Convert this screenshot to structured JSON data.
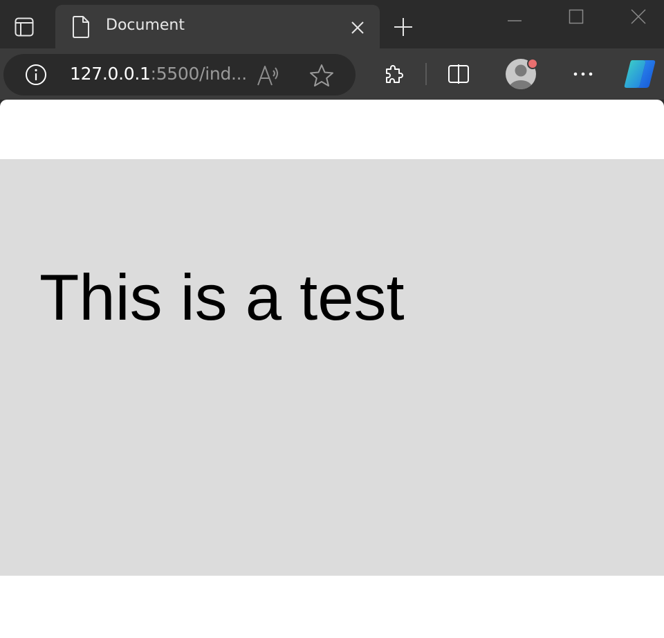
{
  "tab": {
    "title": "Document"
  },
  "address_bar": {
    "url_host": "127.0.0.1",
    "url_rest": ":5500/ind..."
  },
  "page": {
    "heading": "This is a test"
  },
  "colors": {
    "window_bg": "#2b2b2b",
    "toolbar_bg": "#3b3b3b",
    "omnibox_bg": "#2a2a2a",
    "content_bg": "#ffffff",
    "test_box_bg": "#dcdcdc",
    "notification_dot": "#e96f6f"
  },
  "icons": {
    "tab_actions": "tab-actions-icon",
    "favicon": "document-icon",
    "close": "close-icon",
    "new_tab": "plus-icon",
    "minimize": "minimize-icon",
    "maximize": "maximize-icon",
    "window_close": "close-icon",
    "site_info": "info-icon",
    "read_aloud": "read-aloud-icon",
    "favorite": "star-icon",
    "extensions": "puzzle-icon",
    "split_screen": "split-screen-icon",
    "profile": "avatar-icon",
    "more": "more-icon",
    "copilot": "copilot-icon"
  }
}
